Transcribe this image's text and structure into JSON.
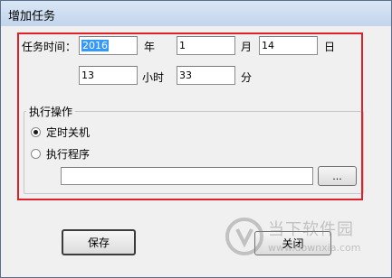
{
  "window": {
    "title": "增加任务"
  },
  "task_time": {
    "label": "任务时间：",
    "year": {
      "value_selected": "2016",
      "unit": "年"
    },
    "month": {
      "value": "1",
      "unit": "月"
    },
    "day": {
      "value": "14",
      "unit": "日"
    },
    "hour": {
      "value": "13",
      "unit": "小时"
    },
    "minute": {
      "value": "33",
      "unit": "分"
    }
  },
  "action_group": {
    "legend": "执行操作",
    "options": [
      {
        "label": "定时关机",
        "selected": true
      },
      {
        "label": "执行程序",
        "selected": false
      }
    ],
    "program_path": {
      "value": ""
    },
    "browse_label": "..."
  },
  "buttons": {
    "save": "保存",
    "close": "关闭"
  },
  "watermark": {
    "brand": "当下软件园",
    "site": "www.downxia.com"
  },
  "colors": {
    "highlight_frame": "#e2202a",
    "selection": "#3399ff"
  }
}
